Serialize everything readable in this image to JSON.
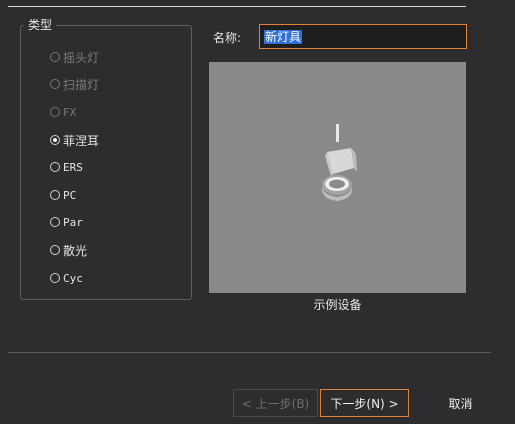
{
  "group": {
    "title": "类型"
  },
  "types": [
    {
      "label": "摇头灯",
      "disabled": true,
      "checked": false
    },
    {
      "label": "扫描灯",
      "disabled": true,
      "checked": false
    },
    {
      "label": "FX",
      "disabled": true,
      "checked": false
    },
    {
      "label": "菲涅耳",
      "disabled": false,
      "checked": true
    },
    {
      "label": "ERS",
      "disabled": false,
      "checked": false
    },
    {
      "label": "PC",
      "disabled": false,
      "checked": false
    },
    {
      "label": "Par",
      "disabled": false,
      "checked": false
    },
    {
      "label": "散光",
      "disabled": false,
      "checked": false
    },
    {
      "label": "Cyc",
      "disabled": false,
      "checked": false
    }
  ],
  "name": {
    "label": "名称:",
    "value": "新灯具"
  },
  "preview": {
    "caption": "示例设备"
  },
  "buttons": {
    "prev": "< 上一步(B)",
    "next": "下一步(N) >",
    "cancel": "取消"
  },
  "colors": {
    "accent": "#e2823a",
    "background": "#2d2d30",
    "preview_bg": "#898989"
  }
}
